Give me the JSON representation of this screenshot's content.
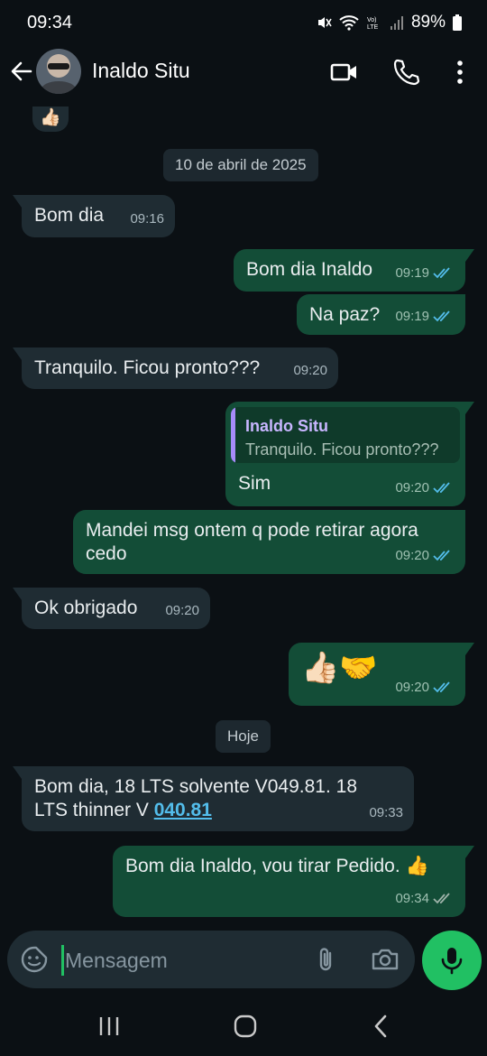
{
  "status": {
    "time": "09:34",
    "battery": "89%",
    "icons": [
      "mute-icon",
      "wifi-icon",
      "volte-icon",
      "signal-icon",
      "battery-icon"
    ]
  },
  "header": {
    "contact_name": "Inaldo Situ",
    "icons": [
      "back-arrow-icon",
      "avatar",
      "video-call-icon",
      "phone-icon",
      "more-vert-icon"
    ]
  },
  "chat": {
    "top_reaction": "👍🏻",
    "date_chip_1": "10 de abril de 2025",
    "date_chip_2": "Hoje",
    "messages": [
      {
        "dir": "in",
        "text": "Bom dia",
        "time": "09:16"
      },
      {
        "dir": "out",
        "text": "Bom dia Inaldo",
        "time": "09:19",
        "status": "read"
      },
      {
        "dir": "out",
        "text": "Na paz?",
        "time": "09:19",
        "status": "read"
      },
      {
        "dir": "in",
        "text": "Tranquilo. Ficou pronto???",
        "time": "09:20"
      },
      {
        "dir": "out",
        "reply_to": {
          "name": "Inaldo Situ",
          "text": "Tranquilo. Ficou pronto???"
        },
        "text": "Sim",
        "time": "09:20",
        "status": "read"
      },
      {
        "dir": "out",
        "text": "Mandei msg ontem  q pode retirar agora\ncedo",
        "time": "09:20",
        "status": "read"
      },
      {
        "dir": "in",
        "text": "Ok obrigado",
        "time": "09:20"
      },
      {
        "dir": "out",
        "text": "👍🏻🤝",
        "time": "09:20",
        "status": "read"
      },
      {
        "dir": "in",
        "text_prefix": "Bom dia, 18 LTS solvente V049.81.   18\nLTS thinner V ",
        "link": "040.81",
        "time": "09:33"
      },
      {
        "dir": "out",
        "text": "Bom dia Inaldo, vou tirar Pedido. 👍",
        "time": "09:34",
        "status": "delivered"
      }
    ]
  },
  "composer": {
    "placeholder": "Mensagem",
    "value": ""
  },
  "colors": {
    "background": "#0b1014",
    "incoming_bubble": "#1f2c33",
    "outgoing_bubble": "#134d37",
    "read_ticks": "#53bdeb",
    "accent": "#21c063"
  }
}
